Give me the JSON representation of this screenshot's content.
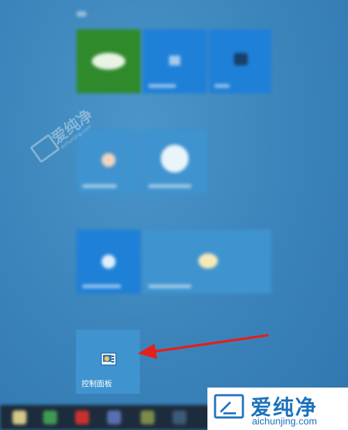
{
  "colors": {
    "desktop": "#3b86bd",
    "tile_blue": "#1f80d8",
    "tile_light": "#3f93cf",
    "tile_green": "#2f8a2c",
    "annotation_arrow": "#e3201c",
    "taskbar": "#1c2c3c",
    "brand_blue": "#1d72bd"
  },
  "start_menu": {
    "control_panel_tile": {
      "label": "控制面板",
      "icon": "control-panel-icon"
    }
  },
  "annotation": {
    "type": "arrow",
    "target": "control-panel-tile"
  },
  "watermark": {
    "brand": "爱纯净",
    "site": "aichunjing.com",
    "logo_icon": "aichunjing-logo-icon"
  }
}
